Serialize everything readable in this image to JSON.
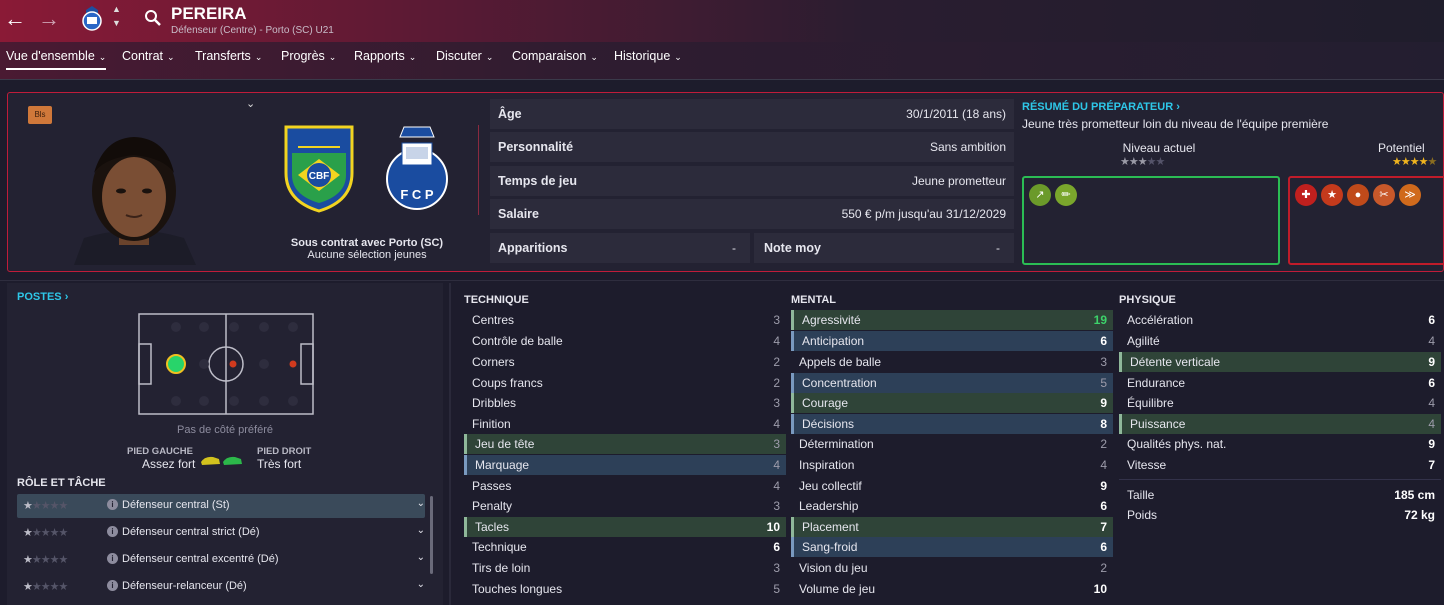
{
  "header": {
    "name": "PEREIRA",
    "subtitle": "Défenseur (Centre) - Porto (SC) U21"
  },
  "menu": [
    "Vue d'ensemble",
    "Contrat",
    "Transferts",
    "Progrès",
    "Rapports",
    "Discuter",
    "Comparaison",
    "Historique"
  ],
  "profile": {
    "badge": "Bls",
    "contract_line1": "Sous contrat avec Porto (SC)",
    "contract_line2": "Aucune sélection jeunes",
    "cbf": "CBF",
    "fcp": "F C P"
  },
  "info": {
    "age_label": "Âge",
    "age": "30/1/2011 (18 ans)",
    "pers_label": "Personnalité",
    "pers": "Sans ambition",
    "play_label": "Temps de jeu",
    "play": "Jeune prometteur",
    "sal_label": "Salaire",
    "sal": "550 € p/m jusqu'au 31/12/2029",
    "app_label": "Apparitions",
    "app": "-",
    "note_label": "Note moy",
    "note": "-"
  },
  "coach": {
    "link": "RÉSUMÉ DU PRÉPARATEUR",
    "text": "Jeune très prometteur loin du niveau de l'équipe première",
    "current_label": "Niveau actuel",
    "potential_label": "Potentiel",
    "current_stars": 3,
    "potential_stars": 4.5
  },
  "positions": {
    "link": "POSTES",
    "side": "Pas de côté préféré",
    "left_foot_label": "PIED GAUCHE",
    "left_foot": "Assez fort",
    "right_foot_label": "PIED DROIT",
    "right_foot": "Très fort"
  },
  "roles": {
    "title": "RÔLE ET TÂCHE",
    "items": [
      "Défenseur central (St)",
      "Défenseur central strict (Dé)",
      "Défenseur central excentré (Dé)",
      "Défenseur-relanceur (Dé)"
    ]
  },
  "technique": {
    "title": "TECHNIQUE",
    "items": [
      [
        "Centres",
        "3"
      ],
      [
        "Contrôle de balle",
        "4"
      ],
      [
        "Corners",
        "2"
      ],
      [
        "Coups francs",
        "2"
      ],
      [
        "Dribbles",
        "3"
      ],
      [
        "Finition",
        "4"
      ],
      [
        "Jeu de tête",
        "3"
      ],
      [
        "Marquage",
        "4"
      ],
      [
        "Passes",
        "4"
      ],
      [
        "Penalty",
        "3"
      ],
      [
        "Tacles",
        "10"
      ],
      [
        "Technique",
        "6"
      ],
      [
        "Tirs de loin",
        "3"
      ],
      [
        "Touches longues",
        "5"
      ]
    ]
  },
  "mental": {
    "title": "MENTAL",
    "items": [
      [
        "Agressivité",
        "19"
      ],
      [
        "Anticipation",
        "6"
      ],
      [
        "Appels de balle",
        "3"
      ],
      [
        "Concentration",
        "5"
      ],
      [
        "Courage",
        "9"
      ],
      [
        "Décisions",
        "8"
      ],
      [
        "Détermination",
        "2"
      ],
      [
        "Inspiration",
        "4"
      ],
      [
        "Jeu collectif",
        "9"
      ],
      [
        "Leadership",
        "6"
      ],
      [
        "Placement",
        "7"
      ],
      [
        "Sang-froid",
        "6"
      ],
      [
        "Vision du jeu",
        "2"
      ],
      [
        "Volume de jeu",
        "10"
      ]
    ]
  },
  "physique": {
    "title": "PHYSIQUE",
    "items": [
      [
        "Accélération",
        "6"
      ],
      [
        "Agilité",
        "4"
      ],
      [
        "Détente verticale",
        "9"
      ],
      [
        "Endurance",
        "6"
      ],
      [
        "Équilibre",
        "4"
      ],
      [
        "Puissance",
        "4"
      ],
      [
        "Qualités phys. nat.",
        "9"
      ],
      [
        "Vitesse",
        "7"
      ]
    ],
    "height_label": "Taille",
    "height": "185 cm",
    "weight_label": "Poids",
    "weight": "72 kg"
  }
}
